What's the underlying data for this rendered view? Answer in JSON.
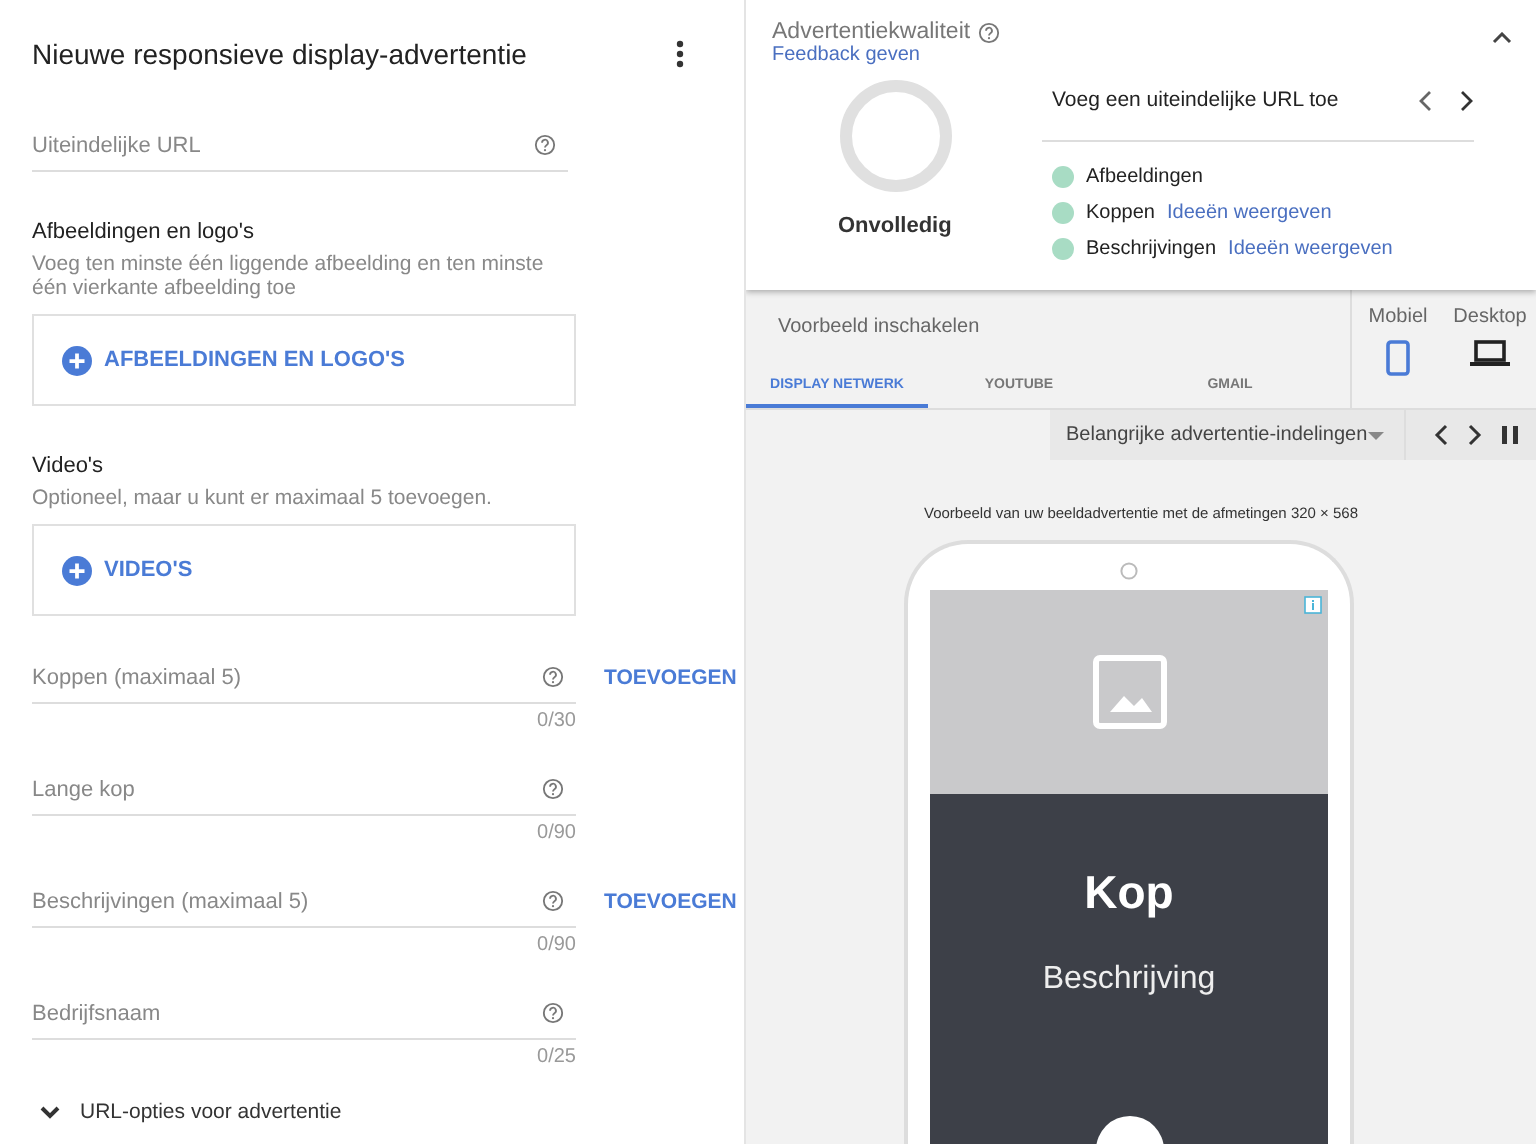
{
  "editor": {
    "title": "Nieuwe responsieve display-advertentie"
  },
  "url_field": {
    "placeholder": "Uiteindelijke URL"
  },
  "media_sections": [
    {
      "heading": "Afbeeldingen en logo's",
      "hint": "Voeg ten minste één liggende afbeelding en ten minste één vierkante afbeelding toe",
      "button": "AFBEELDINGEN EN LOGO'S"
    },
    {
      "heading": "Video's",
      "hint": "Optioneel, maar u kunt er maximaal 5 toevoegen.",
      "button": "VIDEO'S"
    }
  ],
  "text_fields": [
    {
      "placeholder": "Koppen (maximaal 5)",
      "counter": "0/30",
      "add_button": "TOEVOEGEN"
    },
    {
      "placeholder": "Lange kop",
      "counter": "0/90"
    },
    {
      "placeholder": "Beschrijvingen (maximaal 5)",
      "counter": "0/90",
      "add_button": "TOEVOEGEN"
    },
    {
      "placeholder": "Bedrijfsnaam",
      "counter": "0/25"
    }
  ],
  "url_options": {
    "label": "URL-opties voor advertentie",
    "expanded": false
  },
  "quality": {
    "title": "Advertentiekwaliteit",
    "feedback_link": "Feedback geven",
    "status": "Onvolledig",
    "tip": "Voeg een uiteindelijke URL toe",
    "checklist": [
      {
        "label": "Afbeeldingen"
      },
      {
        "label": "Koppen",
        "link": "Ideeën weergeven"
      },
      {
        "label": "Beschrijvingen",
        "link": "Ideeën weergeven"
      }
    ]
  },
  "preview": {
    "toggle_label": "Voorbeeld inschakelen",
    "tabs": [
      {
        "label": "DISPLAY NETWERK",
        "selected": true
      },
      {
        "label": "YOUTUBE",
        "selected": false
      },
      {
        "label": "GMAIL",
        "selected": false
      }
    ],
    "devices": [
      {
        "label": "Mobiel",
        "kind": "phone",
        "selected": true
      },
      {
        "label": "Desktop",
        "kind": "laptop",
        "selected": false
      }
    ],
    "format_dropdown": "Belangrijke advertentie-indelingen",
    "caption": "Voorbeeld van uw beeldadvertentie met de afmetingen 320 × 568",
    "ad": {
      "headline": "Kop",
      "description": "Beschrijving"
    }
  }
}
